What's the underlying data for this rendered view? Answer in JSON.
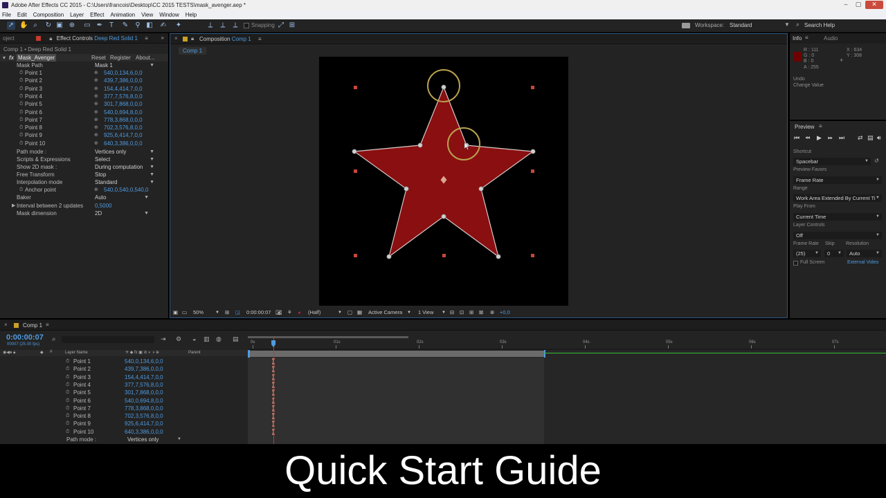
{
  "window": {
    "title": "Adobe After Effects CC 2015 - C:\\Users\\francois\\Desktop\\CC 2015 TESTS\\mask_avenger.aep *"
  },
  "menu": [
    "File",
    "Edit",
    "Composition",
    "Layer",
    "Effect",
    "Animation",
    "View",
    "Window",
    "Help"
  ],
  "toolbar": {
    "snapping_label": "Snapping",
    "workspace_label": "Workspace:",
    "workspace_value": "Standard",
    "search_help": "Search Help"
  },
  "effect_controls": {
    "project_tab": "oject",
    "tab_label": "Effect Controls",
    "tab_layer": "Deep Red Solid 1",
    "breadcrumb": "Comp 1 • Deep Red Solid 1",
    "effect_name": "Mask_Avenger",
    "reset": "Reset",
    "register": "Register",
    "about": "About...",
    "mask_path_label": "Mask Path",
    "mask_path_value": "Mask 1",
    "points": [
      {
        "label": "Point 1",
        "value": "540,0,134,6,0,0"
      },
      {
        "label": "Point 2",
        "value": "439,7,386,0,0,0"
      },
      {
        "label": "Point 3",
        "value": "154,4,414,7,0,0"
      },
      {
        "label": "Point 4",
        "value": "377,7,576,8,0,0"
      },
      {
        "label": "Point 5",
        "value": "301,7,868,0,0,0"
      },
      {
        "label": "Point 6",
        "value": "540,0,694,8,0,0"
      },
      {
        "label": "Point 7",
        "value": "778,3,868,0,0,0"
      },
      {
        "label": "Point 8",
        "value": "702,3,576,8,0,0"
      },
      {
        "label": "Point 9",
        "value": "925,6,414,7,0,0"
      },
      {
        "label": "Point 10",
        "value": "640,3,386,0,0,0"
      }
    ],
    "options": [
      {
        "label": "Path mode :",
        "value": "Vertices only",
        "dropdown": true
      },
      {
        "label": "Scripts & Expressions",
        "value": "Select",
        "dropdown": true
      },
      {
        "label": "Show 2D mask :",
        "value": "During computation",
        "dropdown": true
      },
      {
        "label": "Free Transform",
        "value": "Stop",
        "dropdown": true
      },
      {
        "label": "Interpolation mode",
        "value": "Standard",
        "dropdown": true
      }
    ],
    "anchor_label": "Anchor point",
    "anchor_value": "540,0,540,0,540,0",
    "baker_label": "Baker",
    "baker_value": "Auto",
    "interval_label": "Interval between 2 updates",
    "interval_value": "0,5000",
    "mask_dim_label": "Mask dimension",
    "mask_dim_value": "2D"
  },
  "composition": {
    "tab_label": "Composition",
    "tab_comp": "Comp 1",
    "subtab": "Comp 1",
    "zoom": "50%",
    "timecode": "0:00:00:07",
    "resolution": "(Half)",
    "camera": "Active Camera",
    "views": "1 View",
    "exposure": "+0,0",
    "star_color": "#8a0f10"
  },
  "info": {
    "tab": "Info",
    "tab2": "Audio",
    "r": "R : 111",
    "g": "G : 0",
    "b": "B : 0",
    "a": "A : 255",
    "x": "X : 634",
    "y": "Y : 308",
    "undo": "Undo",
    "change_value": "Change Value",
    "swatch": "#6f0000"
  },
  "preview": {
    "tab": "Preview",
    "shortcut_label": "Shortcut",
    "shortcut_value": "Spacebar",
    "favors_label": "Preview Favors",
    "favors_value": "Frame Rate",
    "range_label": "Range",
    "range_value": "Work Area Extended By Current Ti",
    "play_from_label": "Play From",
    "play_from_value": "Current Time",
    "layer_controls_label": "Layer Controls",
    "layer_controls_value": "Off",
    "frame_rate_label": "Frame Rate",
    "skip_label": "Skip",
    "resolution_label": "Resolution",
    "frame_rate_value": "(25)",
    "skip_value": "0",
    "resolution_value": "Auto",
    "full_screen": "Full Screen",
    "external_video": "External Video"
  },
  "timeline": {
    "tab": "Comp 1",
    "timecode": "0:00:00:07",
    "fps": "00007 (25.00 fps)",
    "col_layer": "Layer Name",
    "col_parent": "Parent",
    "col_hash": "#",
    "ruler": [
      "0s",
      "01s",
      "02s",
      "03s",
      "04s",
      "05s",
      "06s",
      "07s"
    ],
    "path_mode_label": "Path mode :",
    "path_mode_value": "Vertices only"
  },
  "caption": "Quick Start Guide"
}
